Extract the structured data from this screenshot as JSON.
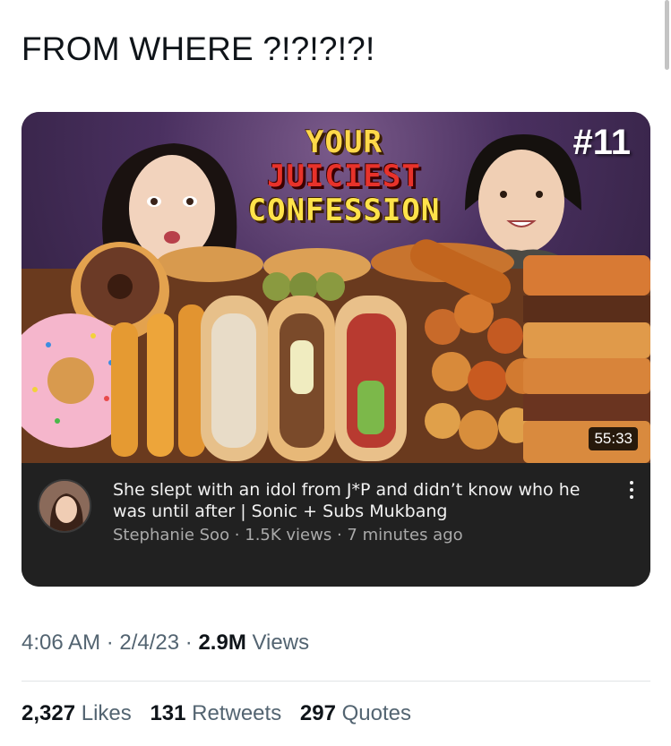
{
  "tweet": {
    "text": "FROM WHERE ?!?!?!?!"
  },
  "video_card": {
    "thumbnail": {
      "title_line1": "YOUR",
      "title_line2": "JUICIEST",
      "title_line3": "CONFESSION",
      "episode": "#11",
      "duration": "55:33"
    },
    "title": "She slept with an idol from J*P and didn’t know who he was until after | Sonic + Subs Mukbang",
    "channel": "Stephanie Soo",
    "views": "1.5K views",
    "age": "7 minutes ago",
    "separator": " · "
  },
  "timestamp": {
    "time": "4:06 AM",
    "date": "2/4/23",
    "views_count": "2.9M",
    "views_label": "Views",
    "sep": " · "
  },
  "stats": {
    "likes_count": "2,327",
    "likes_label": "Likes",
    "retweets_count": "131",
    "retweets_label": "Retweets",
    "quotes_count": "297",
    "quotes_label": "Quotes"
  },
  "icons": [
    "more-vertical-icon"
  ]
}
